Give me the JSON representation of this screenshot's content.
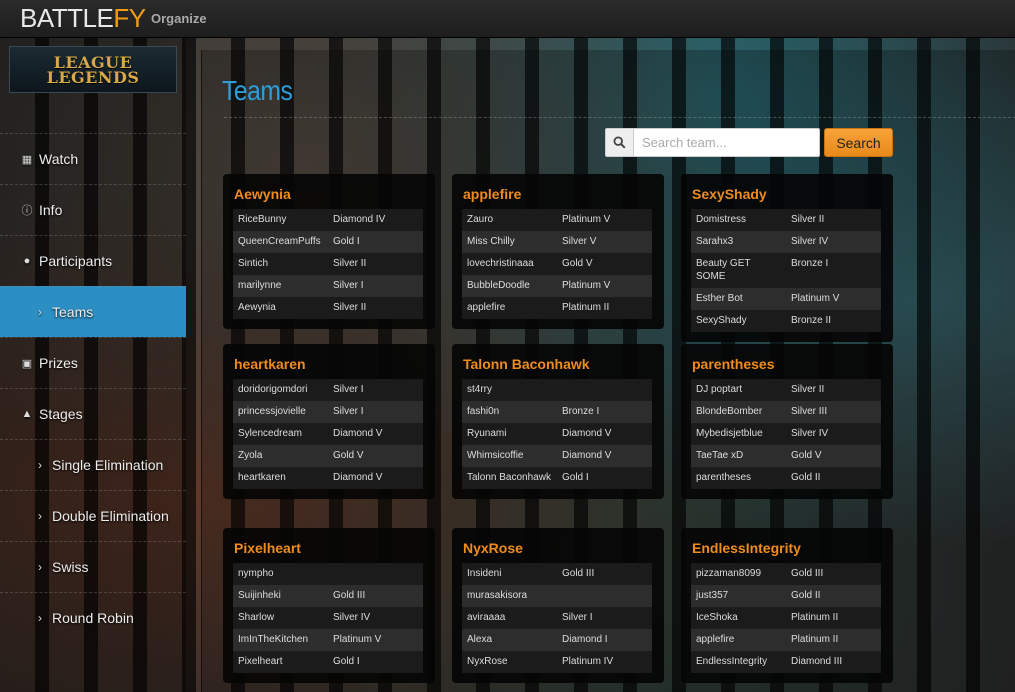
{
  "topbar": {
    "logo_main": "BATTLE",
    "logo_accent": "FY",
    "organize": "Organize"
  },
  "game_logo": {
    "line1": "LEAGUE",
    "line2": "LEGENDS"
  },
  "nav": [
    {
      "label": "Watch",
      "icon": "film-icon"
    },
    {
      "label": "Info",
      "icon": "info-icon"
    },
    {
      "label": "Participants",
      "icon": "user-icon"
    },
    {
      "label": "Teams",
      "icon": "chevron-right-icon",
      "active": true
    },
    {
      "label": "Prizes",
      "icon": "gift-icon"
    },
    {
      "label": "Stages",
      "icon": "sitemap-icon"
    },
    {
      "label": "Single Elimination",
      "icon": "chevron-right-icon"
    },
    {
      "label": "Double Elimination",
      "icon": "chevron-right-icon"
    },
    {
      "label": "Swiss",
      "icon": "chevron-right-icon"
    },
    {
      "label": "Round Robin",
      "icon": "chevron-right-icon"
    }
  ],
  "main": {
    "title": "Teams",
    "search": {
      "placeholder": "Search team...",
      "button": "Search"
    }
  },
  "teams": [
    {
      "name": "Aewynia",
      "players": [
        [
          "RiceBunny",
          "Diamond IV"
        ],
        [
          "QueenCreamPuffs",
          "Gold I"
        ],
        [
          "Sintich",
          "Silver II"
        ],
        [
          "marilynne",
          "Silver I"
        ],
        [
          "Aewynia",
          "Silver II"
        ]
      ]
    },
    {
      "name": "applefire",
      "players": [
        [
          "Zauro",
          "Platinum V"
        ],
        [
          "Miss Chilly",
          "Silver V"
        ],
        [
          "lovechristinaaa",
          "Gold V"
        ],
        [
          "BubbleDoodle",
          "Platinum V"
        ],
        [
          "applefire",
          "Platinum II"
        ]
      ]
    },
    {
      "name": "SexyShady",
      "players": [
        [
          "Domistress",
          "Silver II"
        ],
        [
          "Sarahx3",
          "Silver IV"
        ],
        [
          "Beauty GET SOME",
          "Bronze I"
        ],
        [
          "Esther Bot",
          "Platinum V"
        ],
        [
          "SexyShady",
          "Bronze II"
        ]
      ]
    },
    {
      "name": "heartkaren",
      "players": [
        [
          "doridorigomdori",
          "Silver I"
        ],
        [
          "princessjovielle",
          "Silver I"
        ],
        [
          "Sylencedream",
          "Diamond V"
        ],
        [
          "Zyola",
          "Gold V"
        ],
        [
          "heartkaren",
          "Diamond V"
        ]
      ]
    },
    {
      "name": "Talonn Baconhawk",
      "players": [
        [
          "st4rry",
          ""
        ],
        [
          "fashi0n",
          "Bronze I"
        ],
        [
          "Ryunami",
          "Diamond V"
        ],
        [
          "Whimsicoffie",
          "Diamond V"
        ],
        [
          "Talonn Baconhawk",
          "Gold I"
        ]
      ]
    },
    {
      "name": "parentheses",
      "players": [
        [
          "DJ poptart",
          "Silver II"
        ],
        [
          "BlondeBomber",
          "Silver III"
        ],
        [
          "Mybedisjetblue",
          "Silver IV"
        ],
        [
          "TaeTae xD",
          "Gold V"
        ],
        [
          "parentheses",
          "Gold II"
        ]
      ]
    },
    {
      "name": "Pixelheart",
      "players": [
        [
          "nympho",
          ""
        ],
        [
          "Suijinheki",
          "Gold III"
        ],
        [
          "Sharlow",
          "Silver IV"
        ],
        [
          "ImInTheKitchen",
          "Platinum V"
        ],
        [
          "Pixelheart",
          "Gold I"
        ]
      ]
    },
    {
      "name": "NyxRose",
      "players": [
        [
          "Insideni",
          "Gold III"
        ],
        [
          "murasakisora",
          ""
        ],
        [
          "aviraaaa",
          "Silver I"
        ],
        [
          "Alexa",
          "Diamond I"
        ],
        [
          "NyxRose",
          "Platinum IV"
        ]
      ]
    },
    {
      "name": "EndlessIntegrity",
      "players": [
        [
          "pizzaman8099",
          "Gold III"
        ],
        [
          "just357",
          "Gold II"
        ],
        [
          "IceShoka",
          "Platinum II"
        ],
        [
          "applefire",
          "Platinum II"
        ],
        [
          "EndlessIntegrity",
          "Diamond III"
        ]
      ]
    }
  ]
}
